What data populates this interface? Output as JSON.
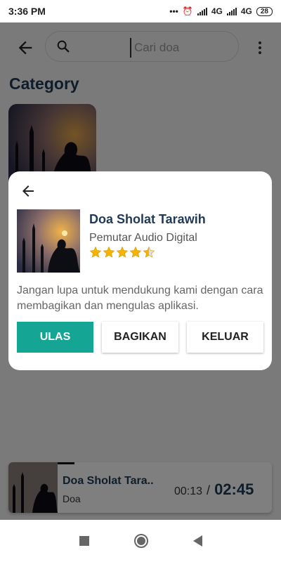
{
  "status": {
    "time": "3:36 PM",
    "net1": "4G",
    "net2": "4G",
    "battery": "28"
  },
  "search": {
    "placeholder": "Cari doa"
  },
  "category": {
    "title": "Category"
  },
  "mini_player": {
    "title": "Doa Sholat Tara..",
    "subtitle": "Doa",
    "current": "00:13",
    "separator": "/",
    "total": "02:45",
    "progress": 0.08
  },
  "dialog": {
    "title": "Doa Sholat Tarawih",
    "subtitle": "Pemutar Audio Digital",
    "rating": 4.5,
    "message": "Jangan lupa untuk mendukung kami dengan cara membagikan dan mengulas aplikasi.",
    "buttons": {
      "rate": "ULAS",
      "share": "BAGIKAN",
      "exit": "KELUAR"
    }
  },
  "colors": {
    "accent": "#14a594",
    "title": "#1f3a56",
    "star": "#f4b400"
  },
  "icons": [
    "back-arrow-icon",
    "search-icon",
    "more-vert-icon",
    "star-icon",
    "stop-icon",
    "home-icon",
    "back-triangle-icon"
  ]
}
